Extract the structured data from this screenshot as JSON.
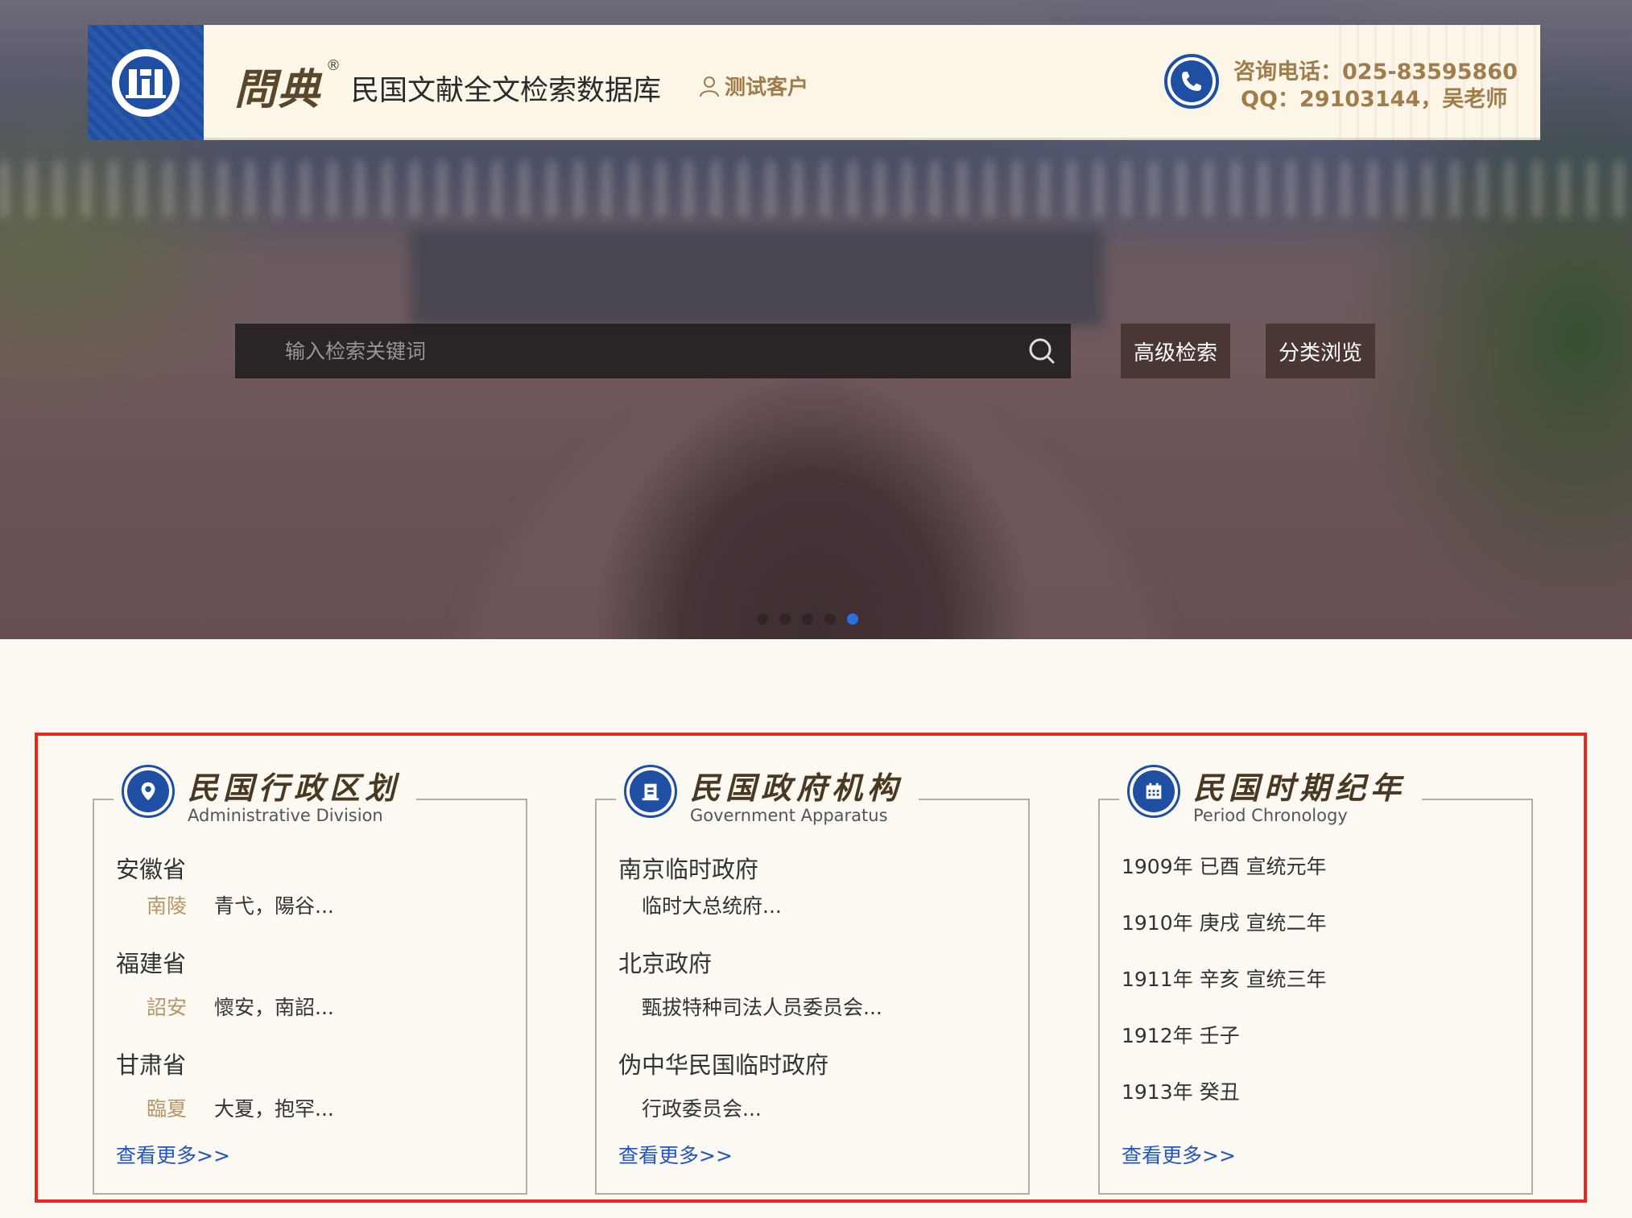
{
  "header": {
    "brand_name": "問典",
    "brand_reg": "®",
    "site_title": "民国文献全文检索数据库",
    "user_label": "测试客户",
    "contact_phone": "咨询电话：025-83595860",
    "contact_qq": "QQ：29103144，吴老师"
  },
  "search": {
    "placeholder": "输入检索关键词",
    "advanced_label": "高级检索",
    "category_label": "分类浏览"
  },
  "carousel": {
    "dots": 5,
    "active_index": 4
  },
  "colors": {
    "brand_blue": "#1e4fa3",
    "gold": "#a07c4a",
    "link_blue": "#2255c4",
    "highlight_red": "#e8281f"
  },
  "panels": {
    "admin": {
      "title_cn": "民国行政区划",
      "title_en": "Administrative Division",
      "icon": "map-pin-icon",
      "provinces": [
        {
          "name": "安徽省",
          "city": "南陵",
          "towns": "青弋，陽谷..."
        },
        {
          "name": "福建省",
          "city": "詔安",
          "towns": "懷安，南詔..."
        },
        {
          "name": "甘肃省",
          "city": "臨夏",
          "towns": "大夏，抱罕..."
        }
      ],
      "more": "查看更多>>"
    },
    "gov": {
      "title_cn": "民国政府机构",
      "title_en": "Government Apparatus",
      "icon": "building-icon",
      "agencies": [
        {
          "name": "南京临时政府",
          "sub": "临时大总统府..."
        },
        {
          "name": "北京政府",
          "sub": "甄拔特种司法人员委员会..."
        },
        {
          "name": "伪中华民国临时政府",
          "sub": "行政委员会..."
        }
      ],
      "more": "查看更多>>"
    },
    "chrono": {
      "title_cn": "民国时期纪年",
      "title_en": "Period Chronology",
      "icon": "calendar-icon",
      "years": [
        "1909年 已酉 宣统元年",
        "1910年 庚戌 宣统二年",
        "1911年 辛亥 宣统三年",
        "1912年 壬子",
        "1913年 癸丑"
      ],
      "more": "查看更多>>"
    }
  }
}
